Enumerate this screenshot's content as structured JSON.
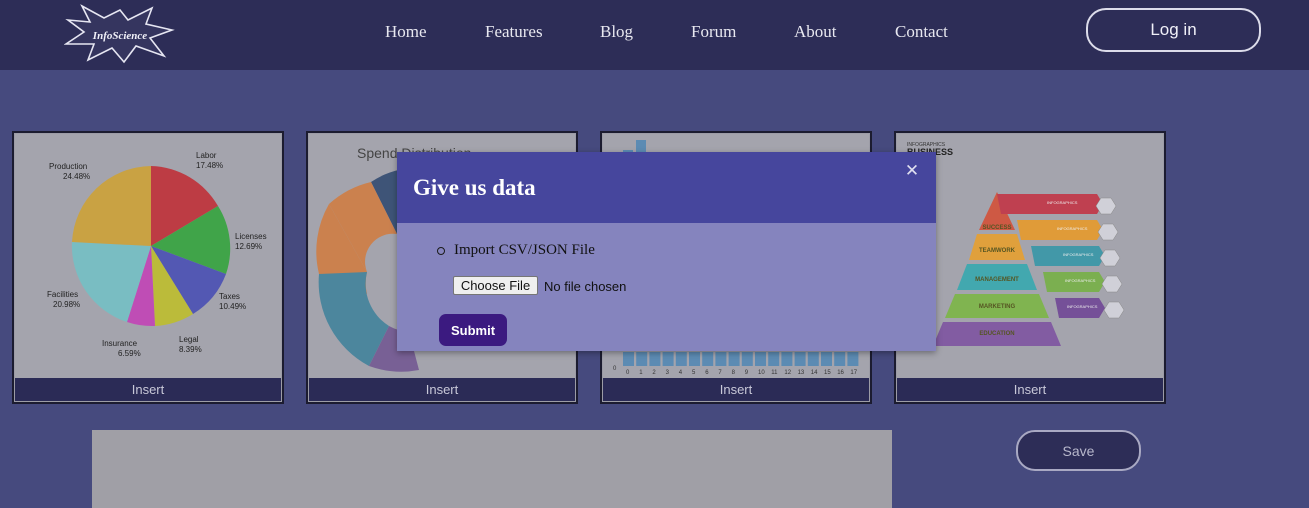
{
  "nav": {
    "logo_text": "InfoScience",
    "links": [
      "Home",
      "Features",
      "Blog",
      "Forum",
      "About",
      "Contact"
    ],
    "login_label": "Log in"
  },
  "cards": [
    {
      "insert_label": "Insert",
      "pie_labels": [
        {
          "name": "Labor",
          "value": "17.48%"
        },
        {
          "name": "Licenses",
          "value": "12.69%"
        },
        {
          "name": "Taxes",
          "value": "10.49%"
        },
        {
          "name": "Legal",
          "value": "8.39%"
        },
        {
          "name": "Insurance",
          "value": "6.59%"
        },
        {
          "name": "Facilities",
          "value": "20.98%"
        },
        {
          "name": "Production",
          "value": "24.48%"
        }
      ]
    },
    {
      "insert_label": "Insert",
      "title": "Spend Distribution"
    },
    {
      "insert_label": "Insert",
      "x_ticks": [
        "0",
        "1",
        "2",
        "3",
        "4",
        "5",
        "6",
        "7",
        "8",
        "9",
        "10",
        "11",
        "12",
        "13",
        "14",
        "15",
        "16",
        "17"
      ],
      "y_zero": "0"
    },
    {
      "insert_label": "Insert",
      "heading_small": "INFOGRAPHICS",
      "heading_big": "BUSINESS",
      "levels": [
        "SUCCESS",
        "TEAMWORK",
        "MANAGEMENT",
        "MARKETING",
        "EDUCATION"
      ],
      "banner_label": "INFOGRAPHICS"
    }
  ],
  "save_label": "Save",
  "modal": {
    "title": "Give us data",
    "close_icon": "close-icon",
    "import_label": "Import CSV/JSON File",
    "choose_file_label": "Choose File",
    "file_status": "No file chosen",
    "submit_label": "Submit"
  },
  "colors": {
    "nav_bg": "#2d2d57",
    "page_bg": "#464a7e",
    "modal_header": "#46469d",
    "modal_body": "#8584be",
    "submit_bg": "#3b1a80"
  }
}
